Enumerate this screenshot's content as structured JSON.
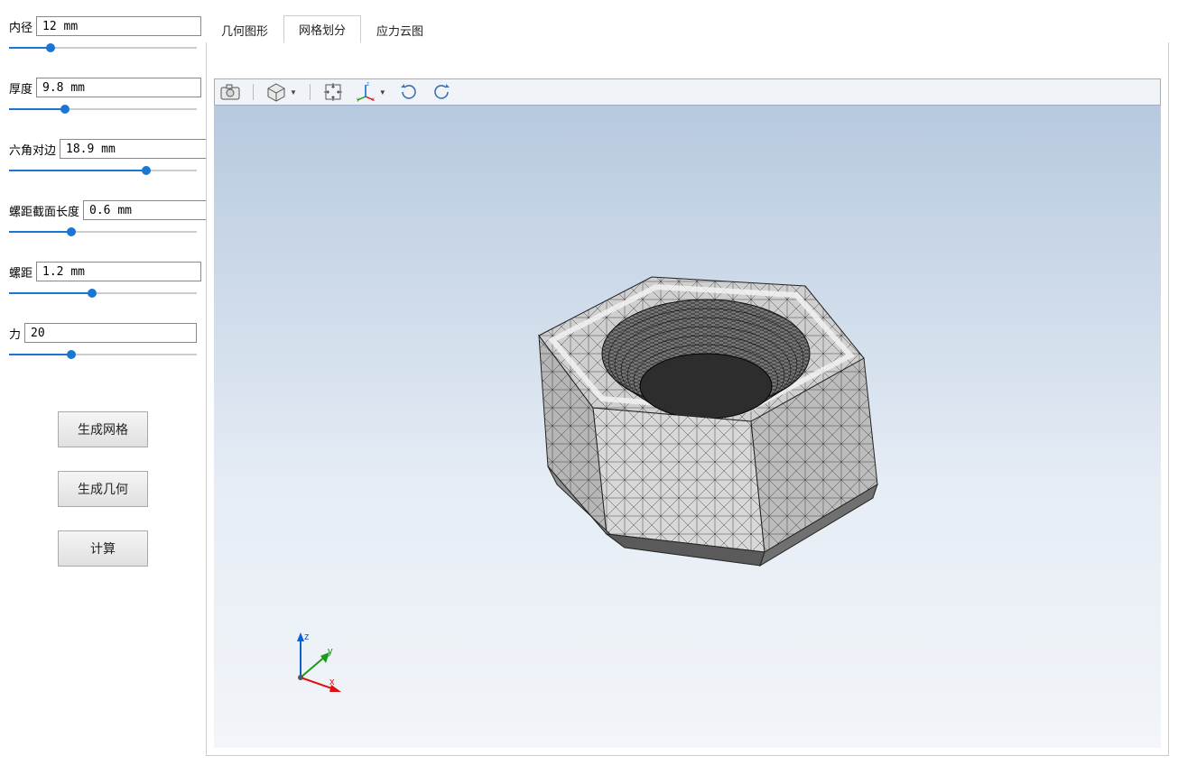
{
  "sidebar": {
    "params": [
      {
        "label": "内径",
        "value": "12 mm",
        "fill": 22
      },
      {
        "label": "厚度",
        "value": "9.8 mm",
        "fill": 30
      },
      {
        "label": "六角对边",
        "value": "18.9 mm",
        "fill": 73
      },
      {
        "label": "螺距截面长度",
        "value": "0.6 mm",
        "fill": 33
      },
      {
        "label": "螺距",
        "value": "1.2 mm",
        "fill": 44
      },
      {
        "label": "力",
        "value": "20",
        "fill": 33
      }
    ],
    "buttons": {
      "generate_mesh": "生成网格",
      "generate_geometry": "生成几何",
      "compute": "计算"
    }
  },
  "tabs": [
    {
      "label": "几何图形",
      "active": false
    },
    {
      "label": "网格划分",
      "active": true
    },
    {
      "label": "应力云图",
      "active": false
    }
  ],
  "toolbar_icons": [
    "camera-icon",
    "cube-view-icon",
    "fit-view-icon",
    "axis-orient-icon",
    "rotate-cw-icon",
    "rotate-ccw-icon"
  ],
  "axis": {
    "x": "x",
    "y": "y",
    "z": "z"
  },
  "model": {
    "type": "hex-nut-mesh",
    "inner_diameter_mm": 12,
    "thickness_mm": 9.8,
    "hex_af_mm": 18.9,
    "pitch_section_len_mm": 0.6,
    "pitch_mm": 1.2,
    "load_force": 20
  }
}
